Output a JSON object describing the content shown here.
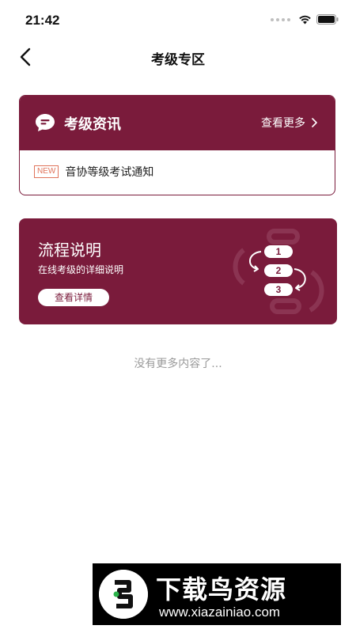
{
  "status_bar": {
    "time": "21:42"
  },
  "nav": {
    "title": "考级专区"
  },
  "news_card": {
    "title": "考级资讯",
    "more_label": "查看更多",
    "items": [
      {
        "badge": "NEW",
        "text": "音协等级考试通知"
      }
    ]
  },
  "flow_card": {
    "title": "流程说明",
    "subtitle": "在线考级的详细说明",
    "button_label": "查看详情",
    "steps": [
      "1",
      "2",
      "3"
    ]
  },
  "footer": {
    "no_more_text": "没有更多内容了..."
  },
  "watermark": {
    "title": "下载鸟资源",
    "url": "www.xiazainiao.com"
  },
  "colors": {
    "brand": "#7a1b3b",
    "badge": "#e0735a",
    "muted": "#9a9a9a"
  }
}
